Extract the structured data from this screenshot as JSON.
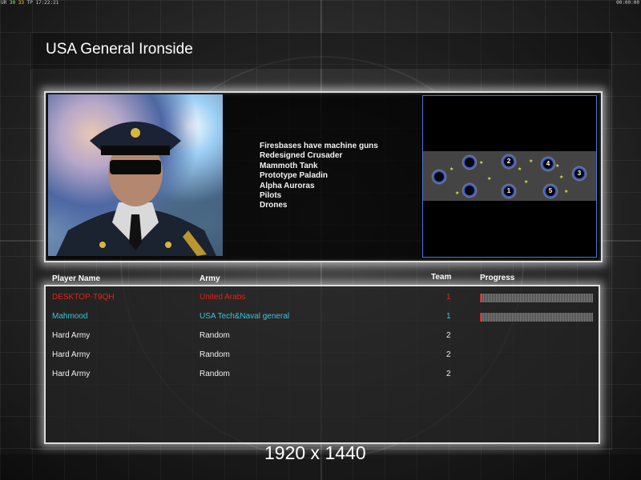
{
  "hud": {
    "left_prefix": "UR",
    "left_a": "30",
    "left_b": "33",
    "left_c": "TP",
    "left_time": "17:22:21",
    "right_time": "00:00:00"
  },
  "general": {
    "title": "USA General Ironside",
    "features": [
      "Firesbases have machine guns",
      "Redesigned Crusader",
      "Mammoth Tank",
      "Prototype Paladin",
      "Alpha Auroras",
      "Pilots",
      "Drones"
    ]
  },
  "map": {
    "slot_labels": [
      "",
      "",
      "2",
      "4",
      "3",
      "",
      "1",
      "5"
    ]
  },
  "table": {
    "headers": {
      "player_name": "Player Name",
      "army": "Army",
      "team": "Team",
      "progress": "Progress"
    },
    "rows": [
      {
        "name": "DESKTOP-T9QH",
        "army": "United Arabs",
        "team": "1",
        "color": "#e2231a",
        "progress": 0.01
      },
      {
        "name": "Mahmood",
        "army": "USA Tech&Naval general",
        "team": "1",
        "color": "#3fc3d8",
        "progress": 0.01
      },
      {
        "name": "Hard Army",
        "army": "Random",
        "team": "2",
        "color": "#f0f0f0",
        "progress": null
      },
      {
        "name": "Hard Army",
        "army": "Random",
        "team": "2",
        "color": "#f0f0f0",
        "progress": null
      },
      {
        "name": "Hard Army",
        "army": "Random",
        "team": "2",
        "color": "#f0f0f0",
        "progress": null
      }
    ]
  },
  "overlay": {
    "resolution": "1920 x 1440"
  },
  "colors": {
    "panel_glow": "#ffffff",
    "map_border": "#4a74d8",
    "slot_ring": "#3456d8",
    "player_red": "#e2231a",
    "player_cyan": "#3fc3d8"
  }
}
